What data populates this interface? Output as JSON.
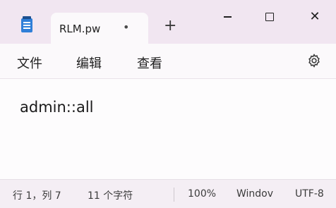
{
  "tab": {
    "title": "RLM.pw",
    "unsaved_dot": "•",
    "new_tab": "+"
  },
  "window_controls": {
    "close": "✕"
  },
  "menu": {
    "file": "文件",
    "edit": "编辑",
    "view": "查看"
  },
  "editor": {
    "content": "admin::all"
  },
  "status": {
    "position": "行 1，列 7",
    "char_count": "11 个字符",
    "zoom": "100%",
    "line_ending": "Windov",
    "encoding": "UTF-8"
  },
  "colors": {
    "titlebar": "#f1e6f1",
    "background": "#fbf9fb",
    "app_icon": "#2f7fd8"
  }
}
